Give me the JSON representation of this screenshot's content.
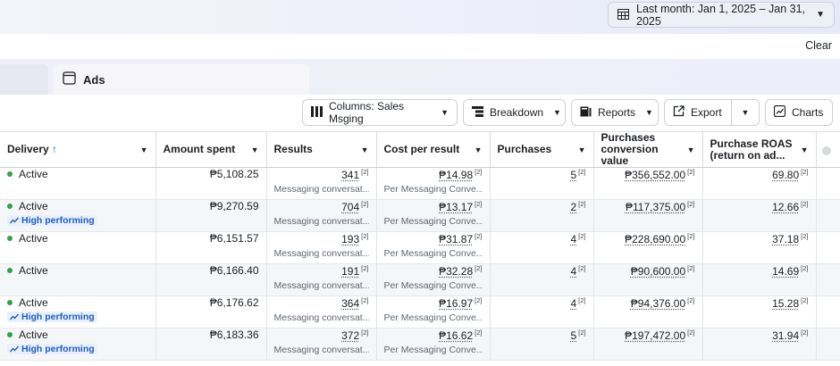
{
  "date_range": {
    "label": "Last month: Jan 1, 2025 – Jan 31, 2025",
    "icon": "calendar-icon"
  },
  "filters": {
    "clear_label": "Clear"
  },
  "tabs": {
    "active_label": "Ads",
    "active_icon": "ad-frame-icon"
  },
  "toolbar": {
    "columns_label": "Columns: Sales Msging",
    "breakdown_label": "Breakdown",
    "reports_label": "Reports",
    "export_label": "Export",
    "charts_label": "Charts"
  },
  "table": {
    "headers": {
      "delivery": "Delivery",
      "delivery_sort": "↑",
      "amount_spent": "Amount spent",
      "results": "Results",
      "cost_per_result": "Cost per result",
      "purchases": "Purchases",
      "pcv_line1": "Purchases",
      "pcv_line2": "conversion value",
      "roas_line1": "Purchase ROAS",
      "roas_line2": "(return on ad..."
    },
    "footnote_marker": "[2]",
    "rows": [
      {
        "status": "Active",
        "tag": "",
        "amount": "₱5,108.25",
        "results": "341",
        "results_sub": "Messaging conversat...",
        "cpr": "₱14.98",
        "cpr_sub": "Per Messaging Conve...",
        "purchases": "5",
        "pcv": "₱356,552.00",
        "roas": "69.80"
      },
      {
        "status": "Active",
        "tag": "High performing",
        "amount": "₱9,270.59",
        "results": "704",
        "results_sub": "Messaging conversat...",
        "cpr": "₱13.17",
        "cpr_sub": "Per Messaging Conve...",
        "purchases": "2",
        "pcv": "₱117,375.00",
        "roas": "12.66"
      },
      {
        "status": "Active",
        "tag": "",
        "amount": "₱6,151.57",
        "results": "193",
        "results_sub": "Messaging conversat...",
        "cpr": "₱31.87",
        "cpr_sub": "Per Messaging Conve...",
        "purchases": "4",
        "pcv": "₱228,690.00",
        "roas": "37.18"
      },
      {
        "status": "Active",
        "tag": "",
        "amount": "₱6,166.40",
        "results": "191",
        "results_sub": "Messaging conversat...",
        "cpr": "₱32.28",
        "cpr_sub": "Per Messaging Conve...",
        "purchases": "4",
        "pcv": "₱90,600.00",
        "roas": "14.69"
      },
      {
        "status": "Active",
        "tag": "High performing",
        "amount": "₱6,176.62",
        "results": "364",
        "results_sub": "Messaging conversat...",
        "cpr": "₱16.97",
        "cpr_sub": "Per Messaging Conve...",
        "purchases": "4",
        "pcv": "₱94,376.00",
        "roas": "15.28"
      },
      {
        "status": "Active",
        "tag": "High performing",
        "amount": "₱6,183.36",
        "results": "372",
        "results_sub": "Messaging conversat...",
        "cpr": "₱16.62",
        "cpr_sub": "Per Messaging Conve...",
        "purchases": "5",
        "pcv": "₱197,472.00",
        "roas": "31.94"
      }
    ]
  },
  "colors": {
    "active_dot": "#31a24c",
    "high_performing": "#1b5fbf"
  }
}
